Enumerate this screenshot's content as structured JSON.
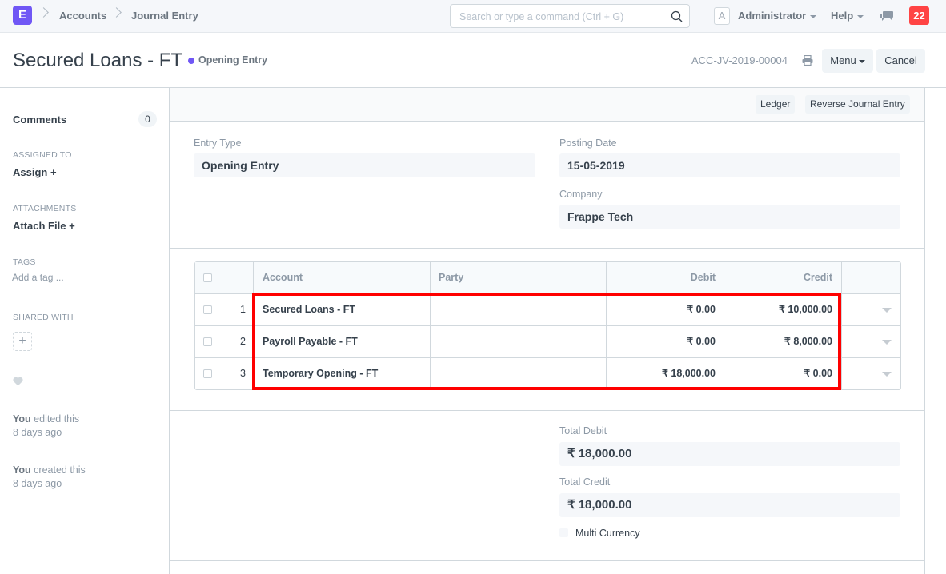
{
  "navbar": {
    "logo": "E",
    "breadcrumbs": [
      "Accounts",
      "Journal Entry"
    ],
    "search_placeholder": "Search or type a command (Ctrl + G)",
    "avatar_initial": "A",
    "user": "Administrator",
    "help": "Help",
    "notification_count": "22"
  },
  "page": {
    "title": "Secured Loans - FT",
    "status": "Opening Entry",
    "status_color": "#7057f5",
    "doc_name": "ACC-JV-2019-00004",
    "menu_label": "Menu",
    "cancel_label": "Cancel"
  },
  "sidebar": {
    "comments_label": "Comments",
    "comments_count": "0",
    "assigned_to_label": "ASSIGNED TO",
    "assign_action": "Assign +",
    "attachments_label": "ATTACHMENTS",
    "attach_action": "Attach File +",
    "tags_label": "TAGS",
    "tag_placeholder": "Add a tag ...",
    "shared_with_label": "SHARED WITH",
    "share_add": "+",
    "activity": [
      {
        "who": "You",
        "action": "edited this",
        "when": "8 days ago"
      },
      {
        "who": "You",
        "action": "created this",
        "when": "8 days ago"
      }
    ]
  },
  "toolbar": {
    "ledger": "Ledger",
    "reverse": "Reverse Journal Entry"
  },
  "form": {
    "entry_type_label": "Entry Type",
    "entry_type_value": "Opening Entry",
    "posting_date_label": "Posting Date",
    "posting_date_value": "15-05-2019",
    "company_label": "Company",
    "company_value": "Frappe Tech"
  },
  "accounts_table": {
    "columns": [
      "",
      "Account",
      "Party",
      "Debit",
      "Credit",
      ""
    ],
    "rows": [
      {
        "idx": "1",
        "account": "Secured Loans - FT",
        "party": "",
        "debit": "₹ 0.00",
        "credit": "₹ 10,000.00"
      },
      {
        "idx": "2",
        "account": "Payroll Payable - FT",
        "party": "",
        "debit": "₹ 0.00",
        "credit": "₹ 8,000.00"
      },
      {
        "idx": "3",
        "account": "Temporary Opening - FT",
        "party": "",
        "debit": "₹ 18,000.00",
        "credit": "₹ 0.00"
      }
    ],
    "highlight_color": "#ff0000"
  },
  "totals": {
    "total_debit_label": "Total Debit",
    "total_debit_value": "₹ 18,000.00",
    "total_credit_label": "Total Credit",
    "total_credit_value": "₹ 18,000.00",
    "multi_currency_label": "Multi Currency"
  }
}
